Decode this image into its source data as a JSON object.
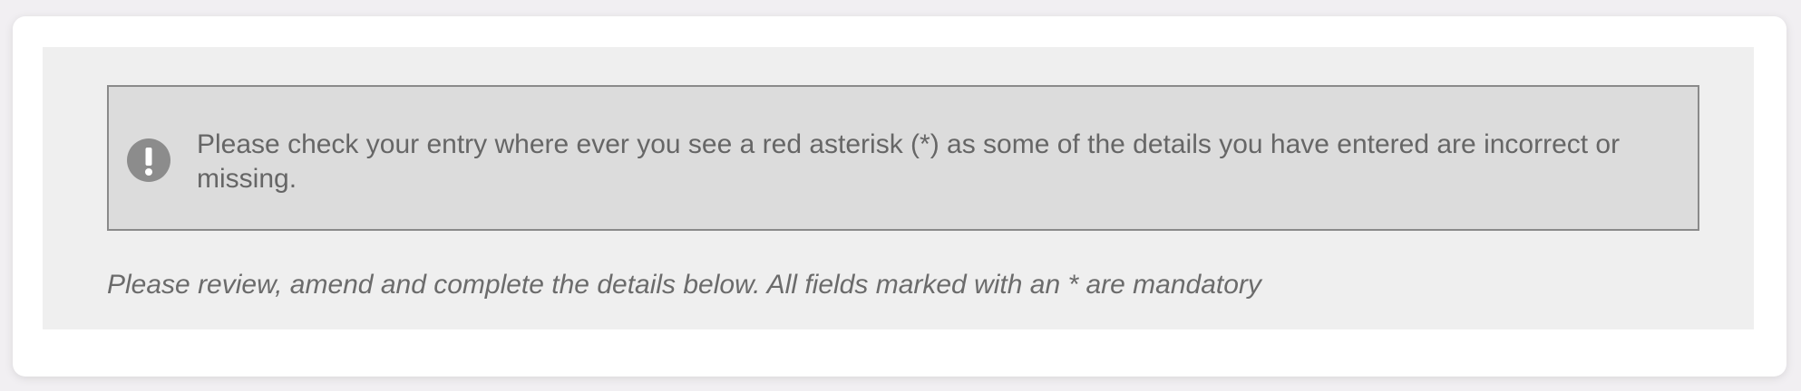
{
  "alert": {
    "icon": "exclamation-circle-icon",
    "message": "Please check your entry where ever you see a red asterisk (*) as some of the details you have entered are incorrect or missing."
  },
  "form": {
    "instructions": "Please review, amend and complete the details below. All fields marked with an * are mandatory"
  },
  "colors": {
    "alert_background": "#dcdcdc",
    "alert_border": "#8a8a8a",
    "icon": "#8c8c8c",
    "text": "#666666"
  }
}
